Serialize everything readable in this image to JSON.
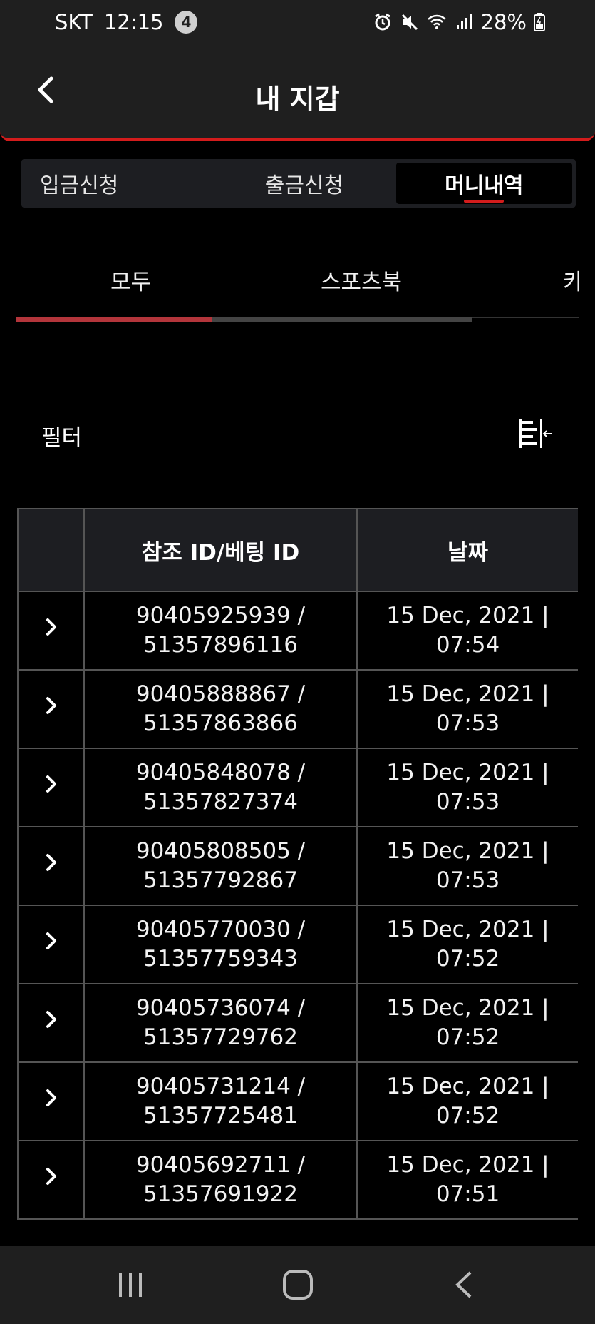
{
  "status_bar": {
    "carrier": "SKT",
    "time": "12:15",
    "notification_count": "4",
    "battery": "28%"
  },
  "header": {
    "title": "내 지갑"
  },
  "top_tabs": [
    {
      "label": "입금신청"
    },
    {
      "label": "출금신청"
    },
    {
      "label": "머니내역"
    }
  ],
  "sub_tabs": [
    {
      "label": "모두"
    },
    {
      "label": "스포츠북"
    },
    {
      "label": "카"
    }
  ],
  "sub_tab_progress": 0.43,
  "filter": {
    "label": "필터"
  },
  "table": {
    "headers": [
      "",
      "참조 ID/베팅 ID",
      "날짜"
    ],
    "rows": [
      {
        "ref": "90405925939 /",
        "bet": "51357896116",
        "date": "15 Dec, 2021 |",
        "time": "07:54"
      },
      {
        "ref": "90405888867 /",
        "bet": "51357863866",
        "date": "15 Dec, 2021 |",
        "time": "07:53"
      },
      {
        "ref": "90405848078 /",
        "bet": "51357827374",
        "date": "15 Dec, 2021 |",
        "time": "07:53"
      },
      {
        "ref": "90405808505 /",
        "bet": "51357792867",
        "date": "15 Dec, 2021 |",
        "time": "07:53"
      },
      {
        "ref": "90405770030 /",
        "bet": "51357759343",
        "date": "15 Dec, 2021 |",
        "time": "07:52"
      },
      {
        "ref": "90405736074 /",
        "bet": "51357729762",
        "date": "15 Dec, 2021 |",
        "time": "07:52"
      },
      {
        "ref": "90405731214 /",
        "bet": "51357725481",
        "date": "15 Dec, 2021 |",
        "time": "07:52"
      },
      {
        "ref": "90405692711 /",
        "bet": "51357691922",
        "date": "15 Dec, 2021 |",
        "time": "07:51"
      }
    ]
  },
  "colors": {
    "accent": "#d31c1c",
    "background": "#000000",
    "surface": "#1f1f1f"
  }
}
